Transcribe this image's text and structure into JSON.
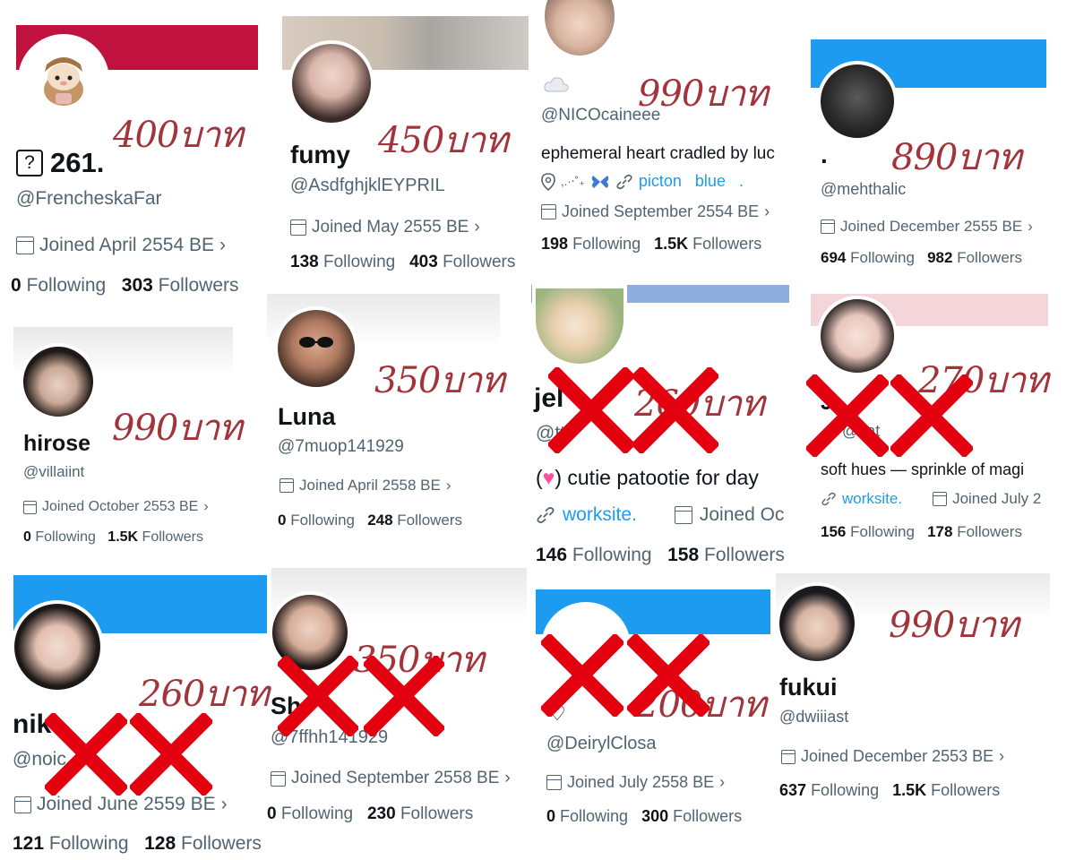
{
  "price_suffix": "บาท",
  "colors": {
    "price": "#a2343c",
    "x": "#e3000f",
    "link": "#1d9bf0",
    "muted": "#536471"
  },
  "cards": [
    {
      "id": "c1",
      "price": "400",
      "name": "261.",
      "name_icon": "question-box-icon",
      "handle": "@FrencheskaFar",
      "joined": "Joined April 2554 BE",
      "following": "0",
      "following_label": "Following",
      "followers": "303",
      "followers_label": "Followers"
    },
    {
      "id": "c2",
      "price": "450",
      "name": "fumy",
      "handle": "@AsdfghjklEYPRIL",
      "joined": "Joined May 2555 BE",
      "following": "138",
      "following_label": "Following",
      "followers": "403",
      "followers_label": "Followers"
    },
    {
      "id": "c3",
      "price": "990",
      "name_icon": "cloud-icon",
      "handle": "@NICOcaineee",
      "bio": "ephemeral heart cradled by luc",
      "location": ",.·‧˚₊",
      "location_icon": "butterfly-icon",
      "website": "picton   blue   .",
      "joined": "Joined September 2554 BE",
      "following": "198",
      "following_label": "Following",
      "followers": "1.5K",
      "followers_label": "Followers"
    },
    {
      "id": "c4",
      "price": "890",
      "name": "·",
      "handle": "@mehthalic",
      "joined": "Joined December 2555 BE",
      "following": "694",
      "following_label": "Following",
      "followers": "982",
      "followers_label": "Followers"
    },
    {
      "id": "c5",
      "price": "990",
      "name": "hirose",
      "handle": "@villaiint",
      "joined": "Joined October 2553 BE",
      "following": "0",
      "following_label": "Following",
      "followers": "1.5K",
      "followers_label": "Followers"
    },
    {
      "id": "c6",
      "price": "350",
      "name": "Luna",
      "handle": "@7muop141929",
      "joined": "Joined April 2558 BE",
      "following": "0",
      "following_label": "Following",
      "followers": "248",
      "followers_label": "Followers"
    },
    {
      "id": "c7",
      "price": "260",
      "name": "jel",
      "handle": "@tt",
      "sold": true,
      "bio": "cutie patootie for day",
      "bio_icon": "heart-icon",
      "website": "worksite.",
      "joined": "Joined Oc",
      "following": "146",
      "following_label": "Following",
      "followers": "158",
      "followers_label": "Followers"
    },
    {
      "id": "c8",
      "price": "270",
      "name": "J",
      "handle": "@kat",
      "sold": true,
      "bio": "soft hues — sprinkle of magi",
      "website": "worksite.",
      "joined": "Joined July 2",
      "following": "156",
      "following_label": "Following",
      "followers": "178",
      "followers_label": "Followers"
    },
    {
      "id": "c9",
      "price": "260",
      "name": "nik",
      "handle": "@noic",
      "sold": true,
      "joined": "Joined June 2559 BE",
      "following": "121",
      "following_label": "Following",
      "followers": "128",
      "followers_label": "Followers"
    },
    {
      "id": "c10",
      "price": "350",
      "name": "Sh",
      "handle": "@7ffhh141929",
      "sold": true,
      "joined": "Joined September 2558 BE",
      "following": "0",
      "following_label": "Following",
      "followers": "230",
      "followers_label": "Followers"
    },
    {
      "id": "c11",
      "price": "200",
      "handle": "@DeirylClosa",
      "sold": true,
      "joined": "Joined July 2558 BE",
      "following": "0",
      "following_label": "Following",
      "followers": "300",
      "followers_label": "Followers"
    },
    {
      "id": "c12",
      "price": "990",
      "name": "fukui",
      "handle": "@dwiiiast",
      "joined": "Joined December 2553 BE",
      "following": "637",
      "following_label": "Following",
      "followers": "1.5K",
      "followers_label": "Followers"
    }
  ]
}
